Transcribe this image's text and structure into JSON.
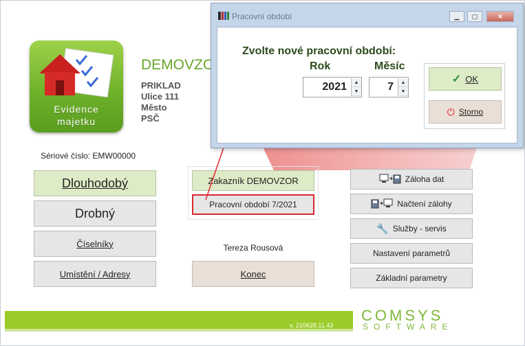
{
  "app": {
    "logo_line1": "Evidence",
    "logo_line2": "majetku",
    "company": "DEMOVZOR",
    "address": [
      "PRIKLAD",
      "Ulice 111",
      "Město",
      "PSČ"
    ],
    "serial": "Sériové číslo: EMW00000"
  },
  "left_buttons": [
    "Dlouhodobý",
    "Drobný",
    "Číselníky",
    "Umístění / Adresy"
  ],
  "center": {
    "customer": "Zakazník  DEMOVZOR",
    "period": "Pracovní období  7/2021",
    "user": "Tereza Rousová",
    "exit": "Konec"
  },
  "right_buttons": {
    "backup": "Záloha dat",
    "restore": "Načtení zálohy",
    "services": "Služby - servis",
    "settings": "Nastavení parametrů",
    "basic": "Základní parametry"
  },
  "footer": {
    "version": "v. 210628.11.43",
    "brand": "COMSYS",
    "brand_sub": "SOFTWARE"
  },
  "dialog": {
    "title": "Pracovní období",
    "heading": "Zvolte nové pracovní období:",
    "year_label": "Rok",
    "month_label": "Měsíc",
    "year_value": "2021",
    "month_value": "7",
    "ok_label": "OK",
    "cancel_label": "Storno",
    "titlebar_buttons": [
      "minimize-icon",
      "maximize-icon",
      "close-icon"
    ]
  },
  "colors": {
    "accent_green": "#9bcc29",
    "highlight_red": "#d9272e"
  }
}
